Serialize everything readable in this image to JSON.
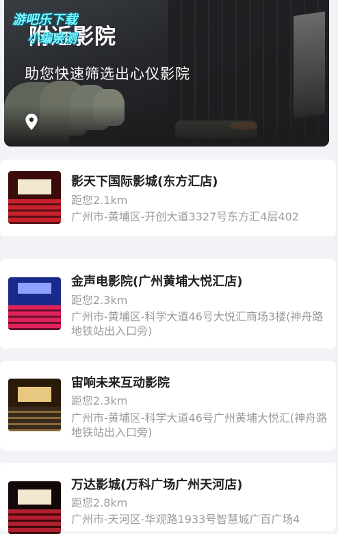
{
  "banner": {
    "title": "附近影院",
    "subtitle": "助您快速筛选出心仪影院",
    "icon": "location-pin-icon"
  },
  "watermark": {
    "line1": "游吧乐下载",
    "line2": "小编亲测"
  },
  "cinemas": [
    {
      "name": "影天下国际影城(东方汇店)",
      "distance": "距您2.1km",
      "address": "广州市-黄埔区-开创大道3327号东方汇4层402"
    },
    {
      "name": "金声电影院(广州黄埔大悦汇店)",
      "distance": "距您2.3km",
      "address": "广州市-黄埔区-科学大道46号大悦汇商场3楼(神舟路地铁站出入口旁)"
    },
    {
      "name": "宙响未来互动影院",
      "distance": "距您2.3km",
      "address": "广州市-黄埔区-科学大道46号广州黄埔大悦汇(神舟路地铁站出入口旁)"
    },
    {
      "name": "万达影城(万科广场广州天河店)",
      "distance": "距您2.8km",
      "address": "广州市-天河区-华观路1933号智慧城广百广场4"
    }
  ]
}
